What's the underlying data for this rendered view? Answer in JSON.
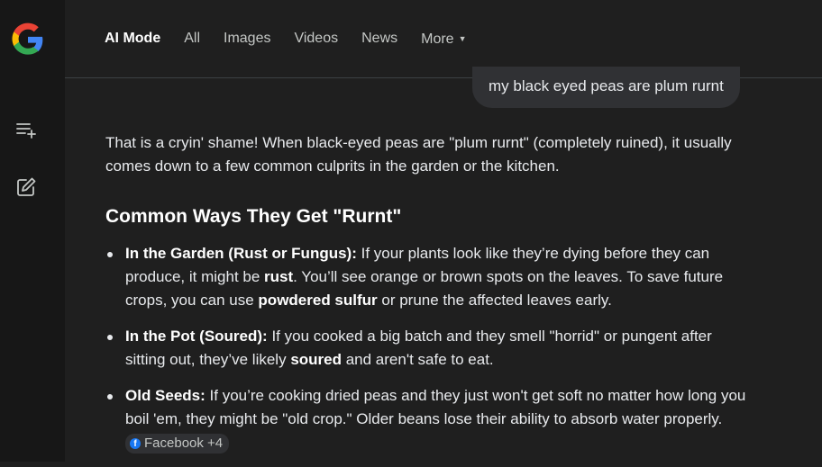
{
  "tabs": [
    {
      "label": "AI Mode",
      "active": true
    },
    {
      "label": "All"
    },
    {
      "label": "Images"
    },
    {
      "label": "Videos"
    },
    {
      "label": "News"
    },
    {
      "label": "More"
    }
  ],
  "rail": {
    "icons": [
      "google-logo",
      "new-thread-icon",
      "edit-icon"
    ]
  },
  "query": "my black eyed peas are plum rurnt",
  "answer": {
    "intro": "That is a cryin' shame! When black-eyed peas are \"plum rurnt\" (completely ruined), it usually comes down to a few common culprits in the garden or the kitchen.",
    "heading": "Common Ways They Get \"Rurnt\"",
    "bullets": [
      {
        "title": "In the Garden (Rust or Fungus):",
        "t1": " If your plants look like they’re dying before they can produce, it might be ",
        "b1": "rust",
        "t2": ". You’ll see orange or brown spots on the leaves. To save future crops, you can use ",
        "b2": "powdered sulfur",
        "t3": " or prune the affected leaves early."
      },
      {
        "title": "In the Pot (Soured):",
        "t1": " If you cooked a big batch and they smell \"horrid\" or pungent after sitting out, they’ve likely ",
        "b1": "soured",
        "t2": " and aren't safe to eat."
      },
      {
        "title": "Old Seeds:",
        "t1": " If you’re cooking dried peas and they just won't get soft no matter how long you boil 'em, they might be \"old crop.\" Older beans lose their ability to absorb water properly. ",
        "source": "Facebook +4"
      }
    ]
  },
  "colors": {
    "background": "#1f1f1f",
    "rail": "#171717",
    "bubble": "#303134",
    "facebook": "#1877f2"
  }
}
